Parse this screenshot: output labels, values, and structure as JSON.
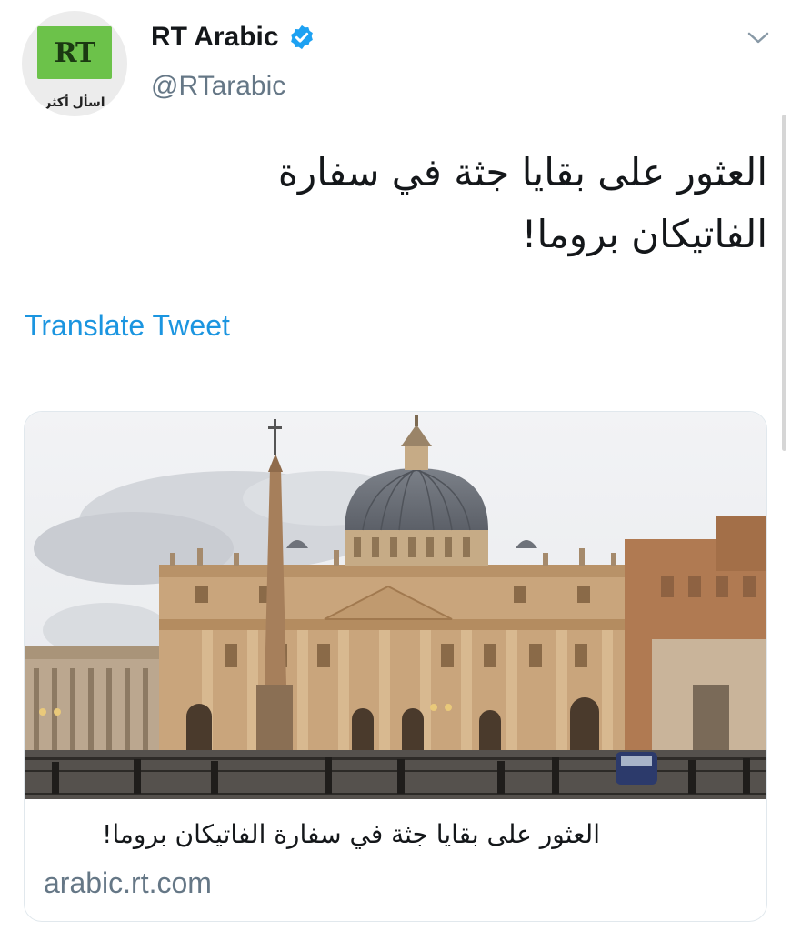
{
  "account": {
    "display_name": "RT Arabic",
    "handle": "@RTarabic",
    "verified": true,
    "avatar_logo_text": "RT",
    "avatar_tagline": "اسأل أكثر"
  },
  "icons": {
    "verified": "verified-badge-icon",
    "menu": "chevron-down-icon"
  },
  "tweet": {
    "text": "العثور على بقايا جثة في سفارة الفاتيكان بروما!",
    "translate_label": "Translate Tweet"
  },
  "card": {
    "image_alt": "St. Peter's Basilica",
    "title": "العثور على بقايا جثة في سفارة الفاتيكان بروما!",
    "domain": "arabic.rt.com"
  },
  "colors": {
    "link": "#1b95e0",
    "secondary_text": "#657786",
    "verified": "#1da1f2",
    "rt_green": "#6cc24a"
  }
}
